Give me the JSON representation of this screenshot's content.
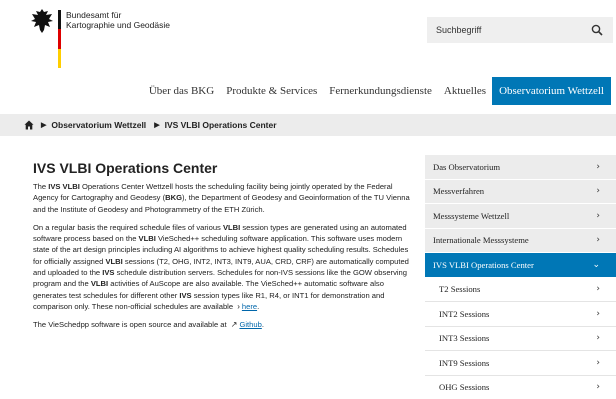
{
  "header": {
    "org_line1": "Bundesamt für",
    "org_line2": "Kartographie und Geodäsie",
    "search_placeholder": "Suchbegriff"
  },
  "nav": {
    "items": [
      {
        "label": "Über das BKG"
      },
      {
        "label": "Produkte & Services"
      },
      {
        "label": "Fernerkundungsdienste"
      },
      {
        "label": "Aktuelles"
      },
      {
        "label": "Observatorium Wettzell",
        "active": true
      }
    ]
  },
  "breadcrumb": {
    "items": [
      "Observatorium Wettzell",
      "IVS VLBI Operations Center"
    ]
  },
  "content": {
    "title": "IVS VLBI Operations Center",
    "p1": {
      "t1": "The ",
      "b1": "IVS VLBI",
      "t2": " Operations Center Wettzell hosts the scheduling facility being jointly operated by the Federal Agency for Cartography and Geodesy (",
      "b2": "BKG",
      "t3": "), the Department of Geodesy and Geoinformation of the TU Vienna and the Institute of Geodesy and Photogrammetry of the ETH Zürich."
    },
    "p2": {
      "t1": "On a regular basis the required schedule files of various ",
      "b1": "VLBI",
      "t2": " session types are generated using an automated software process based on the ",
      "b2": "VLBI",
      "t3": " VieSched++ scheduling software application. This software uses modern state of the art design principles including AI algorithms to achieve highest quality scheduling results. Schedules for officially assigned ",
      "b3": "VLBI",
      "t4": " sessions (T2, OHG, INT2, INT3, INT9, AUA, CRD, CRF) are automatically computed and uploaded to the ",
      "b4": "IVS",
      "t5": " schedule distribution servers. Schedules for non-IVS sessions like the GOW observing program and the ",
      "b5": "VLBI",
      "t6": " activities of AuScope are also available. The VieSched++ automatic software also generates test schedules for different other ",
      "b6": "IVS",
      "t7": " session types like R1, R4, or INT1 for demonstration and comparison only. These non-official schedules are available ",
      "link": "here",
      "t8": "."
    },
    "p3": {
      "t1": "The VieSchedpp software is open source and available at ",
      "link": "Github",
      "t2": "."
    }
  },
  "sidebar": {
    "items": [
      {
        "label": "Das Observatorium"
      },
      {
        "label": "Messverfahren"
      },
      {
        "label": "Messsysteme Wettzell"
      },
      {
        "label": "Internationale Messsysteme"
      },
      {
        "label": "IVS VLBI Operations Center",
        "active": true
      },
      {
        "label": "T2 Sessions"
      },
      {
        "label": "INT2 Sessions"
      },
      {
        "label": "INT3 Sessions"
      },
      {
        "label": "INT9 Sessions"
      },
      {
        "label": "OHG Sessions"
      }
    ]
  },
  "colors": {
    "accent": "#0077b6",
    "panel": "#ececec",
    "link": "#0066aa"
  }
}
